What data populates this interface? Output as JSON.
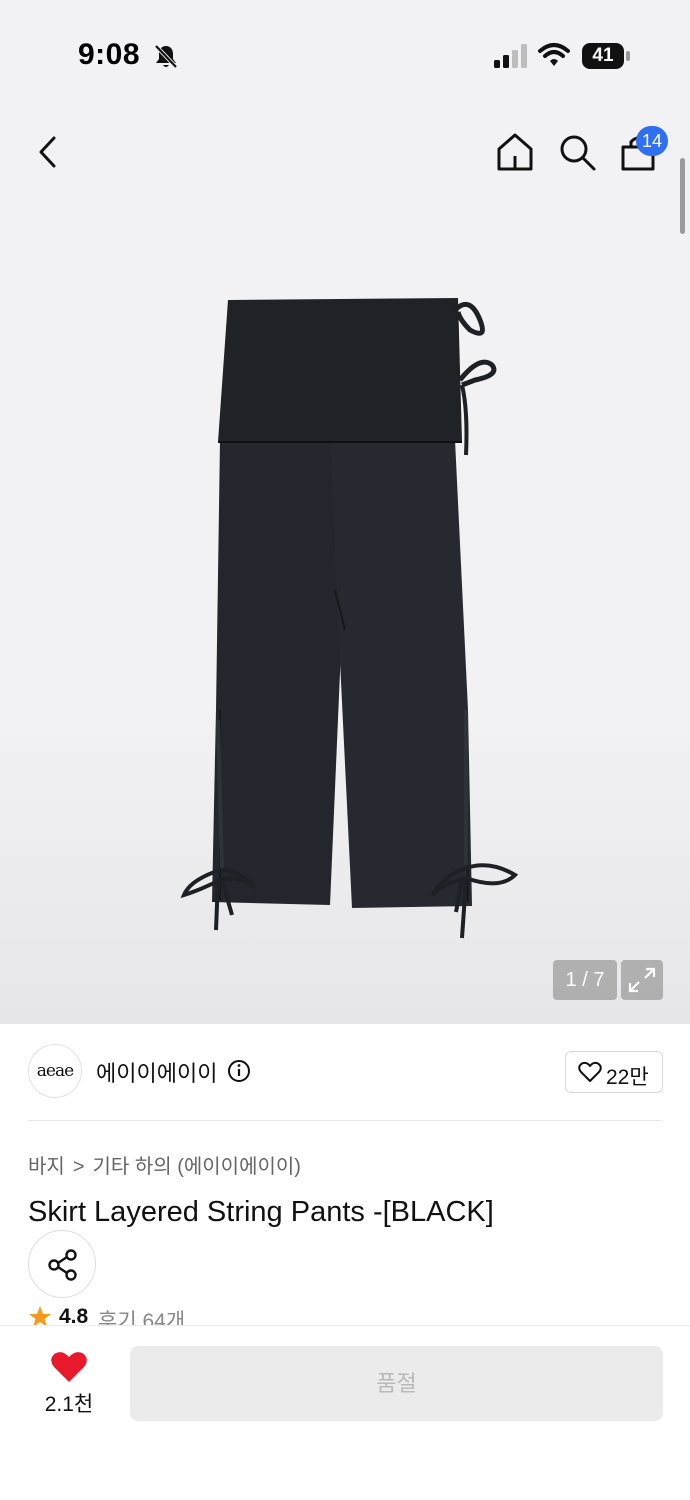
{
  "status_bar": {
    "time": "9:08",
    "battery": "41"
  },
  "nav": {
    "cart_badge": "14"
  },
  "gallery": {
    "counter": "1 / 7"
  },
  "brand": {
    "logo_text": "aeae",
    "name": "에이이에이이",
    "like_count": "22만"
  },
  "breadcrumb": {
    "category": "바지",
    "separator": ">",
    "subcategory": "기타 하의 (에이이에이이)"
  },
  "product": {
    "title": "Skirt Layered String Pants -[BLACK]",
    "rating": "4.8",
    "reviews": "후기 64개"
  },
  "bottom_bar": {
    "wish_count": "2.1천",
    "soldout_label": "품절"
  },
  "colors": {
    "accent_blue": "#2f6ff2",
    "heart_red": "#e8192c",
    "star_orange": "#f59a1a"
  }
}
